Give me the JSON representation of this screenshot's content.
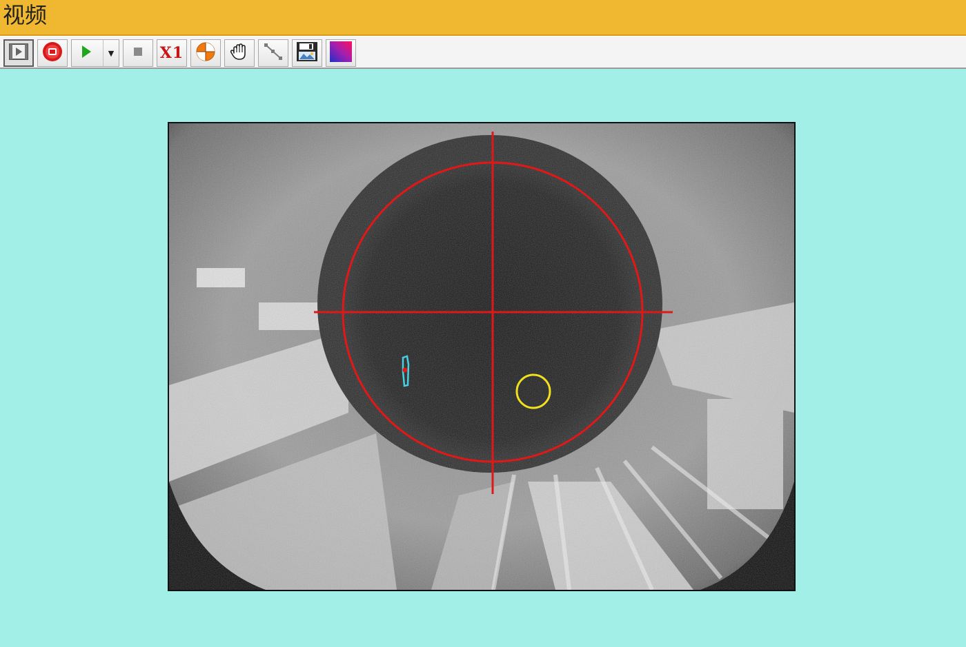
{
  "window": {
    "title": "视频"
  },
  "toolbar": {
    "buttons": [
      {
        "name": "frame-step-button",
        "icon": "film-frame-icon"
      },
      {
        "name": "record-button",
        "icon": "record-icon"
      },
      {
        "name": "play-button",
        "icon": "play-icon"
      },
      {
        "name": "stop-button",
        "icon": "stop-icon"
      },
      {
        "name": "zoom-button",
        "icon": "zoom-label",
        "label": "X1"
      },
      {
        "name": "target-button",
        "icon": "target-icon"
      },
      {
        "name": "pan-button",
        "icon": "hand-icon"
      },
      {
        "name": "measure-button",
        "icon": "line-tool-icon"
      },
      {
        "name": "save-image-button",
        "icon": "save-image-icon"
      },
      {
        "name": "color-button",
        "icon": "color-palette-icon"
      }
    ]
  },
  "colors": {
    "title_bar": "#f0b830",
    "background": "#a2efe8",
    "overlay_circle": "#e01818",
    "crosshair": "#e01818",
    "marker_circle": "#f0e020",
    "glint": "#48d0e0"
  }
}
